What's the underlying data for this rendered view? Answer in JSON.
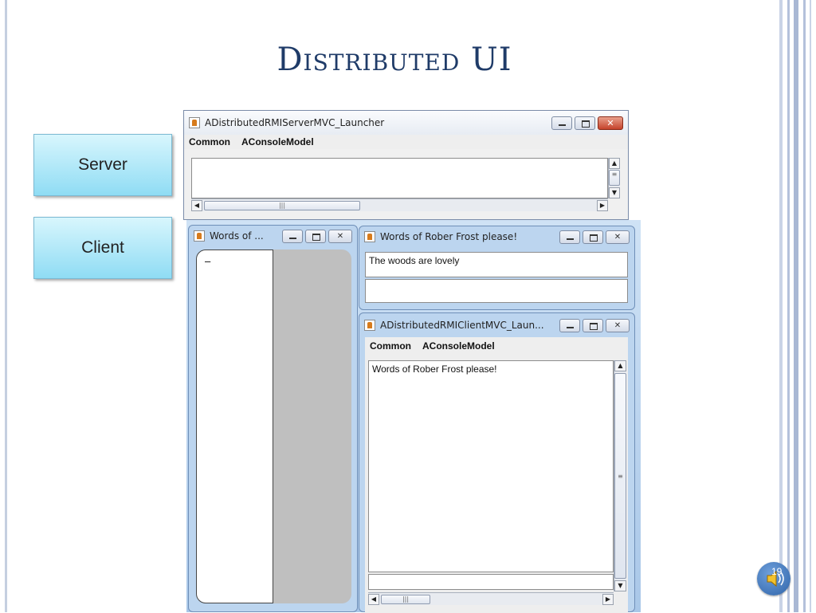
{
  "slide": {
    "title": "Distributed UI",
    "page_number": "19"
  },
  "labels": {
    "server": "Server",
    "client": "Client"
  },
  "server_window": {
    "title": "ADistributedRMIServerMVC_Launcher",
    "menu": [
      "Common",
      "AConsoleModel"
    ],
    "console_text": ""
  },
  "narrow_window": {
    "title": "Words of ...",
    "field_text": "–"
  },
  "words_window": {
    "title": "Words of Rober Frost please!",
    "output_text": "The woods are lovely",
    "input_value": ""
  },
  "client_window": {
    "title": "ADistributedRMIClientMVC_Laun...",
    "menu": [
      "Common",
      "AConsoleModel"
    ],
    "console_text": "Words of Rober Frost please!"
  },
  "icons": [
    "java-app-icon",
    "minimize-icon",
    "maximize-icon",
    "close-icon",
    "speaker-icon"
  ],
  "colors": {
    "title": "#1f3b68",
    "label_box": "#8fdcf4",
    "aero_frame": "#bcd5ef"
  }
}
